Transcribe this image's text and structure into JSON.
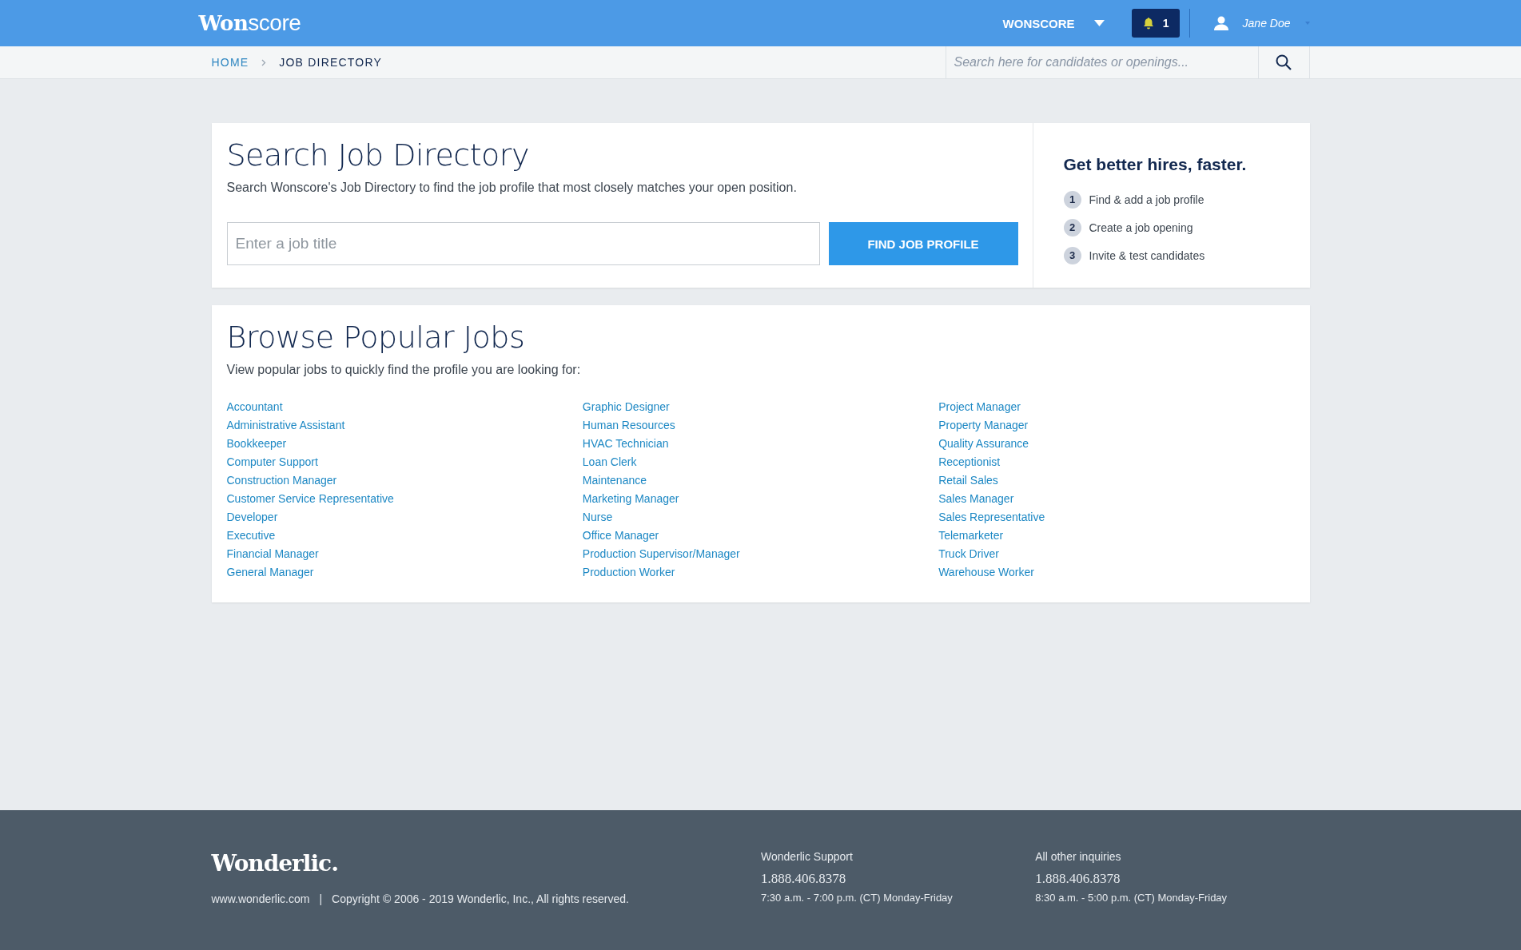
{
  "header": {
    "logo": "**Won**score",
    "account_menu": "WONSCORE",
    "notifications": {
      "count": "1"
    },
    "user": "Jane Doe"
  },
  "breadcrumbs": [
    {
      "label": "HOME",
      "selected": false
    },
    {
      "label": "JOB DIRECTORY",
      "selected": true
    }
  ],
  "global_search": {
    "placeholder": "Search here for candidates or openings..."
  },
  "search_card": {
    "title": "Search Job Directory",
    "description": "Search Wonscore's Job Directory to find the job profile that most closely matches your open position.",
    "field": {
      "placeholder": "Enter a job title"
    },
    "button": "FIND JOB PROFILE"
  },
  "tips": {
    "title": "Get better hires, faster.",
    "steps": [
      {
        "number": "1",
        "text": "Find & add a job profile"
      },
      {
        "number": "2",
        "text": "Create a job opening"
      },
      {
        "number": "3",
        "text": "Invite & test candidates"
      }
    ]
  },
  "browse": {
    "title": "Browse Popular Jobs",
    "description": "View popular jobs to quickly find the profile you are looking for:",
    "columns": [
      [
        "Accountant",
        "Administrative Assistant",
        "Bookkeeper",
        "Computer Support",
        "Construction Manager",
        "Customer Service Representative",
        "Developer",
        "Executive",
        "Financial Manager",
        "General Manager"
      ],
      [
        "Graphic Designer",
        "Human Resources",
        "HVAC Technician",
        "Loan Clerk",
        "Maintenance",
        "Marketing Manager",
        "Nurse",
        "Office Manager",
        "Production Supervisor/Manager",
        "Production Worker"
      ],
      [
        "Project Manager",
        "Property Manager",
        "Quality Assurance",
        "Receptionist",
        "Retail Sales",
        "Sales Manager",
        "Sales Representative",
        "Telemarketer",
        "Truck Driver",
        "Warehouse Worker"
      ]
    ]
  },
  "footer": {
    "logo": "Wonderlic.",
    "website": "www.wonderlic.com",
    "separator": "|",
    "copyright": "Copyright © 2006 - 2019 Wonderlic, Inc., All rights reserved.",
    "contacts": [
      {
        "title": "Wonderlic Support",
        "phone": "1.888.406.8378",
        "hours": "7:30 a.m. - 7:00 p.m. (CT) Monday-Friday"
      },
      {
        "title": "All other inquiries",
        "phone": "1.888.406.8378",
        "hours": "8:30 a.m. - 5:00 p.m. (CT) Monday-Friday"
      }
    ]
  }
}
